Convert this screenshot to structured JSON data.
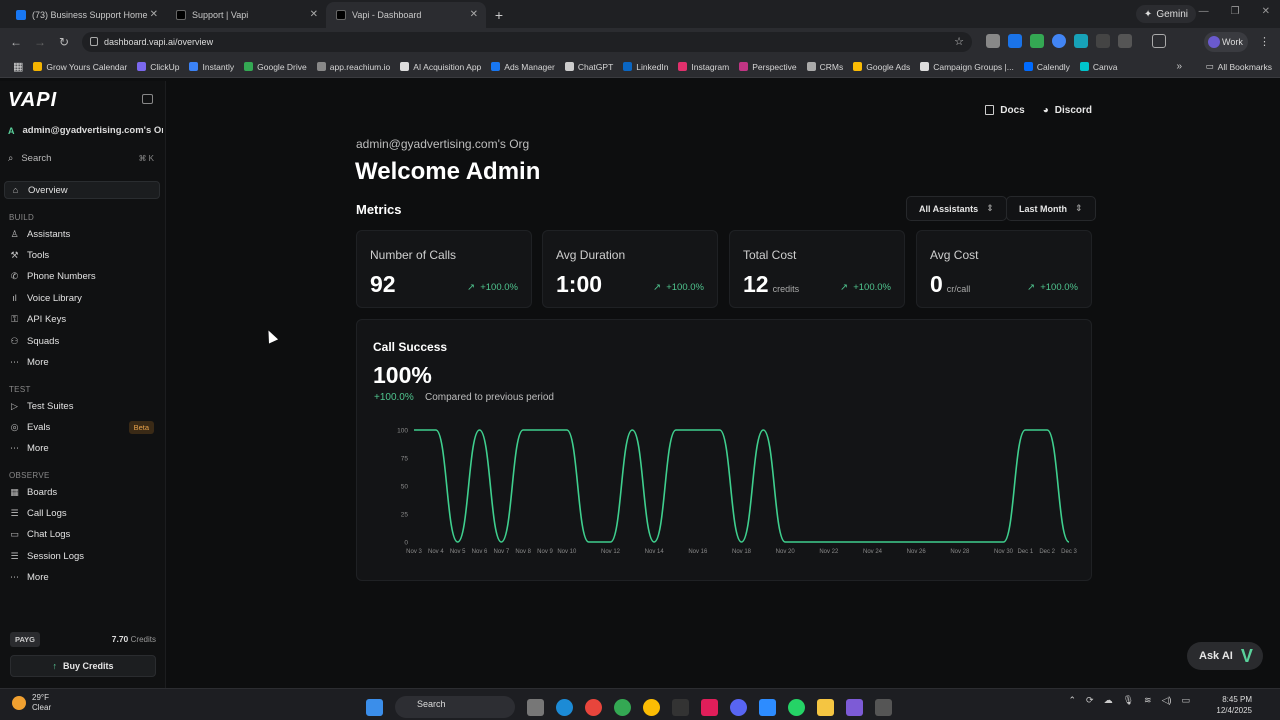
{
  "browser": {
    "tabs": [
      {
        "title": "(73) Business Support Home"
      },
      {
        "title": "Support | Vapi"
      },
      {
        "title": "Vapi - Dashboard"
      }
    ],
    "gemini_label": "Gemini",
    "url": "dashboard.vapi.ai/overview",
    "profile": "Work",
    "bookmarks": [
      {
        "label": "Grow Yours Calendar",
        "color": "#f4b400"
      },
      {
        "label": "ClickUp",
        "color": "#7b68ee"
      },
      {
        "label": "Instantly",
        "color": "#3b82f6"
      },
      {
        "label": "Google Drive",
        "color": "#34a853"
      },
      {
        "label": "app.reachium.io",
        "color": "#888888"
      },
      {
        "label": "AI Acquisition App",
        "color": "#dddddd"
      },
      {
        "label": "Ads Manager",
        "color": "#1877f2"
      },
      {
        "label": "ChatGPT",
        "color": "#cccccc"
      },
      {
        "label": "LinkedIn",
        "color": "#0a66c2"
      },
      {
        "label": "Instagram",
        "color": "#e1306c"
      },
      {
        "label": "Perspective",
        "color": "#c13584"
      },
      {
        "label": "CRMs",
        "color": "#aaaaaa"
      },
      {
        "label": "Google Ads",
        "color": "#fbbc04"
      },
      {
        "label": "Campaign Groups |...",
        "color": "#dddddd"
      },
      {
        "label": "Calendly",
        "color": "#006bff"
      },
      {
        "label": "Canva",
        "color": "#00c4cc"
      }
    ],
    "all_bookmarks": "All Bookmarks"
  },
  "sidebar": {
    "logo": "VAPI",
    "org_initial": "A",
    "org": "admin@gyadvertising.com's Org",
    "search_placeholder": "Search",
    "search_shortcut": "⌘ K",
    "overview": "Overview",
    "build_label": "BUILD",
    "build_items": [
      "Assistants",
      "Tools",
      "Phone Numbers",
      "Voice Library",
      "API Keys",
      "Squads",
      "More"
    ],
    "test_label": "TEST",
    "test_items": [
      "Test Suites",
      "Evals",
      "More"
    ],
    "beta": "Beta",
    "observe_label": "OBSERVE",
    "observe_items": [
      "Boards",
      "Call Logs",
      "Chat Logs",
      "Session Logs",
      "More"
    ],
    "plan": "PAYG",
    "credits_amount": "7.70",
    "credits_unit": "Credits",
    "buy_credits": "Buy Credits"
  },
  "header": {
    "docs": "Docs",
    "discord": "Discord"
  },
  "main": {
    "org_label": "admin@gyadvertising.com's Org",
    "welcome": "Welcome Admin",
    "metrics_title": "Metrics",
    "filter_assistants": "All Assistants",
    "filter_period": "Last Month",
    "cards": [
      {
        "label": "Number of Calls",
        "value": "92",
        "unit": "",
        "change": "+100.0%"
      },
      {
        "label": "Avg Duration",
        "value": "1:00",
        "unit": "",
        "change": "+100.0%"
      },
      {
        "label": "Total Cost",
        "value": "12",
        "unit": "credits",
        "change": "+100.0%"
      },
      {
        "label": "Avg Cost",
        "value": "0",
        "unit": "cr/call",
        "change": "+100.0%"
      }
    ],
    "call_success": {
      "title": "Call Success",
      "value": "100%",
      "change": "+100.0%",
      "compare": "Compared to previous period"
    }
  },
  "chart_data": {
    "type": "line",
    "x": [
      "Nov 3",
      "Nov 4",
      "Nov 5",
      "Nov 6",
      "Nov 7",
      "Nov 8",
      "Nov 9",
      "Nov 10",
      "Nov 11",
      "Nov 12",
      "Nov 13",
      "Nov 14",
      "Nov 15",
      "Nov 16",
      "Nov 17",
      "Nov 18",
      "Nov 19",
      "Nov 20",
      "Nov 21",
      "Nov 22",
      "Nov 23",
      "Nov 24",
      "Nov 25",
      "Nov 26",
      "Nov 27",
      "Nov 28",
      "Nov 29",
      "Nov 30",
      "Dec 1",
      "Dec 2",
      "Dec 3"
    ],
    "tick_labels": [
      "Nov 3",
      "Nov 4",
      "Nov 5",
      "Nov 6",
      "Nov 7",
      "Nov 8",
      "Nov 9",
      "Nov 10",
      "Nov 12",
      "Nov 14",
      "Nov 16",
      "Nov 18",
      "Nov 20",
      "Nov 22",
      "Nov 24",
      "Nov 26",
      "Nov 28",
      "Nov 30",
      "Dec 1",
      "Dec 2",
      "Dec 3"
    ],
    "series": [
      {
        "values": [
          100,
          100,
          0,
          100,
          0,
          100,
          100,
          100,
          0,
          0,
          100,
          0,
          100,
          100,
          100,
          0,
          100,
          0,
          0,
          0,
          0,
          0,
          0,
          0,
          0,
          0,
          0,
          0,
          100,
          100,
          0
        ]
      }
    ],
    "yticks": [
      0,
      25,
      50,
      75,
      100
    ],
    "ylim": [
      0,
      100
    ],
    "color": "#3fcf8e",
    "grid": false
  },
  "ask_ai": "Ask AI",
  "taskbar": {
    "temp": "29°F",
    "condition": "Clear",
    "search": "Search",
    "time": "8:45 PM",
    "date": "12/4/2025"
  }
}
